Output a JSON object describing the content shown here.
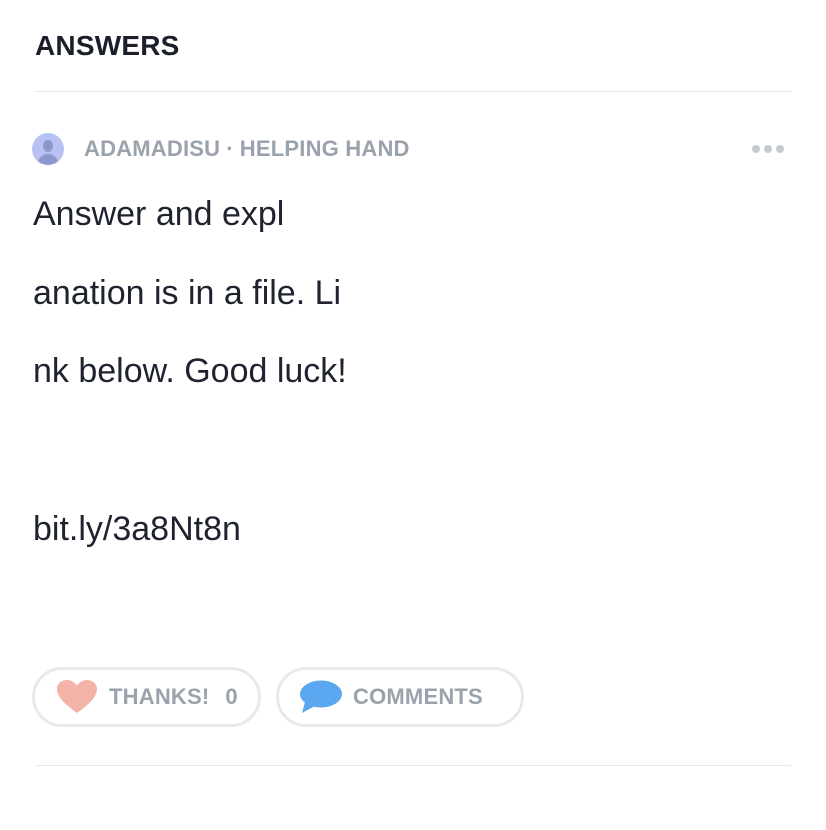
{
  "section": {
    "title": "ANSWERS"
  },
  "answer": {
    "author_name": "ADAMADISU",
    "separator": "·",
    "author_rank": "HELPING HAND",
    "body_lines": [
      "Answer and expl",
      "anation is in a file. Li",
      "nk below. Good luck!",
      "bit.ly/3a8Nt8n"
    ],
    "more_icon": "more-horizontal-icon"
  },
  "actions": {
    "thanks_label": "THANKS!",
    "thanks_count": "0",
    "comments_label": "COMMENTS",
    "heart_icon": "heart-icon",
    "comment_icon": "comment-bubble-icon"
  },
  "colors": {
    "heart": "#f4b3a8",
    "comment": "#5ba8f0",
    "muted_text": "#9aa2ad",
    "border": "#e7e9ec",
    "avatar_bg": "#b8c2f2"
  }
}
